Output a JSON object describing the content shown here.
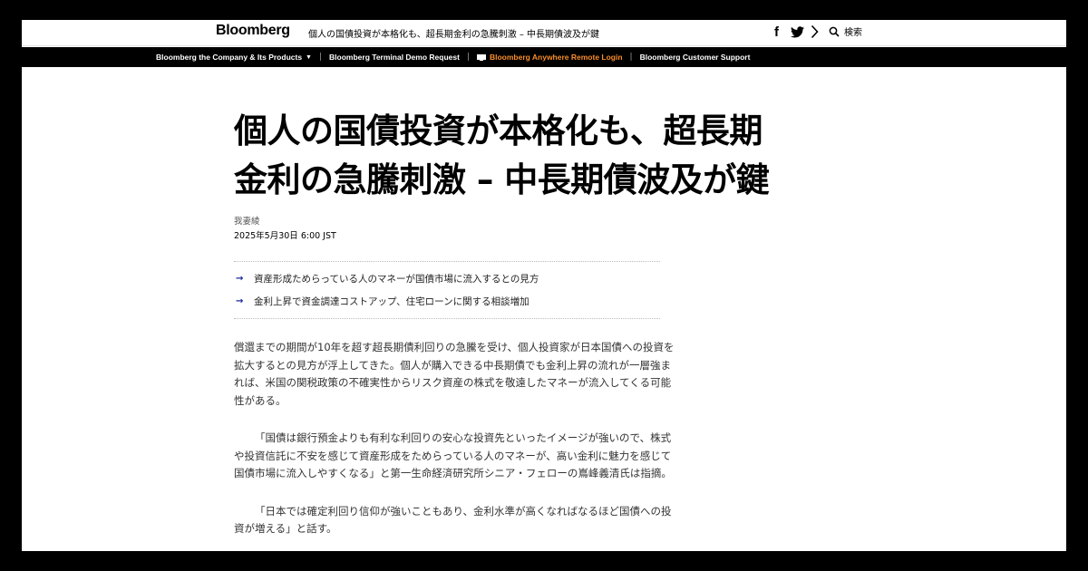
{
  "header": {
    "logo": "Bloomberg",
    "headline": "個人の国債投資が本格化も、超長期金利の急騰刺激 – 中長期債波及が鍵",
    "social": {
      "facebook": "f"
    },
    "search_label": "検索"
  },
  "nav": {
    "items": [
      "Bloomberg the Company & Its Products",
      "Bloomberg Terminal Demo Request",
      "Bloomberg Anywhere Remote Login",
      "Bloomberg Customer Support"
    ],
    "accent_color": "#f98e2b"
  },
  "article": {
    "title_line1": "個人の国債投資が本格化も、超長期",
    "title_line2": "金利の急騰刺激 – 中長期債波及が鍵",
    "author": "我妻綾",
    "date": "2025年5月30日 6:00 JST",
    "summary": [
      "資産形成ためらっている人のマネーが国債市場に流入するとの見方",
      "金利上昇で資金調達コストアップ、住宅ローンに関する相談増加"
    ],
    "paragraphs": [
      "償還までの期間が10年を超す超長期債利回りの急騰を受け、個人投資家が日本国債への投資を拡大するとの見方が浮上してきた。個人が購入できる中長期債でも金利上昇の流れが一層強まれば、米国の関税政策の不確実性からリスク資産の株式を敬遠したマネーが流入してくる可能性がある。",
      "「国債は銀行預金よりも有利な利回りの安心な投資先といったイメージが強いので、株式や投資信託に不安を感じて資産形成をためらっている人のマネーが、高い金利に魅力を感じて国債市場に流入しやすくなる」と第一生命経済研究所シニア・フェローの嶌峰義清氏は指摘。",
      "「日本では確定利回り信仰が強いこともあり、金利水準が高くなればなるほど国債への投資が増える」と話す。"
    ]
  }
}
